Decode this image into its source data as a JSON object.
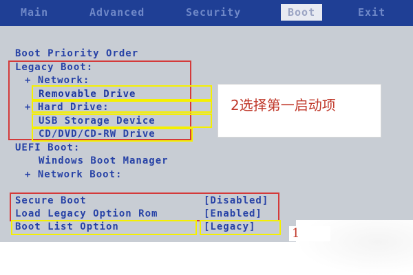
{
  "tabs": [
    "Main",
    "Advanced",
    "Security",
    "Boot",
    "Exit"
  ],
  "section_title": "Boot Priority Order",
  "legacy_boot": "Legacy Boot:",
  "network": "+ Network:",
  "removable_drive": "Removable Drive",
  "hard_drive": "+ Hard Drive:",
  "usb_storage": "USB Storage Device",
  "cd_dvd": "CD/DVD/CD-RW Drive",
  "uefi_boot": "UEFI Boot:",
  "windows_boot_manager": "Windows Boot Manager",
  "network_boot": "+ Network Boot:",
  "secure_boot": {
    "label": "Secure Boot",
    "value": "[Disabled]"
  },
  "load_legacy": {
    "label": "Load Legacy Option Rom",
    "value": "[Enabled]"
  },
  "boot_list": {
    "label": "Boot List Option",
    "value": "[Legacy]"
  },
  "annotation_2": "2选择第一启动项",
  "annotation_1": "1",
  "colors": {
    "menubar": "#1f3f95",
    "text": "#2742a6",
    "highlight_red": "#d43a3a",
    "highlight_yellow": "#f5f000"
  }
}
